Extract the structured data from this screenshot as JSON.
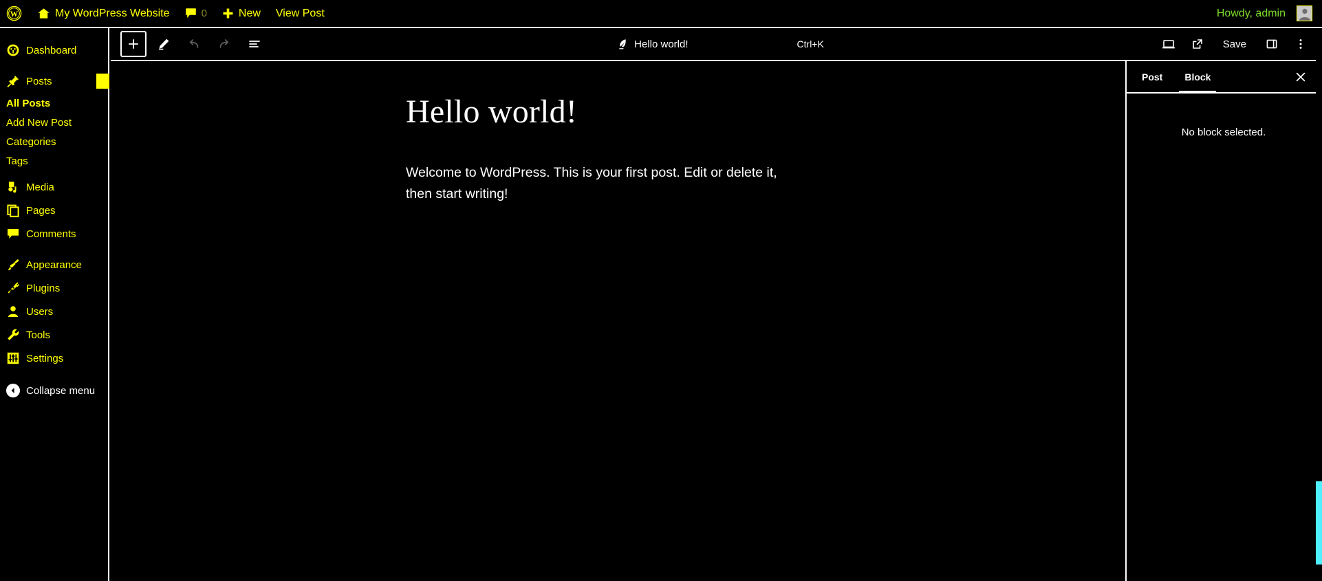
{
  "admin_bar": {
    "logo_icon": "wordpress-logo-icon",
    "site_icon": "home-icon",
    "site_name": "My WordPress Website",
    "comments_icon": "comment-bubble-icon",
    "comments_count": "0",
    "new_icon": "plus-icon",
    "new_label": "New",
    "view_post_label": "View Post",
    "howdy_label": "Howdy, admin",
    "avatar_icon": "user-avatar-icon",
    "howdy_color": "#7ddc2b",
    "accent_color": "#ffff00"
  },
  "sidebar": {
    "items": [
      {
        "label": "Dashboard",
        "icon": "dashboard-gauge-icon"
      },
      {
        "label": "Posts",
        "icon": "pin-icon",
        "current": true
      },
      {
        "label": "Media",
        "icon": "media-music-icon"
      },
      {
        "label": "Pages",
        "icon": "page-document-icon"
      },
      {
        "label": "Comments",
        "icon": "comment-bubble-icon"
      },
      {
        "label": "Appearance",
        "icon": "paint-brush-icon"
      },
      {
        "label": "Plugins",
        "icon": "plug-icon"
      },
      {
        "label": "Users",
        "icon": "user-icon"
      },
      {
        "label": "Tools",
        "icon": "wrench-icon"
      },
      {
        "label": "Settings",
        "icon": "settings-sliders-icon"
      }
    ],
    "posts_submenu": [
      {
        "label": "All Posts",
        "current": true
      },
      {
        "label": "Add New Post",
        "current": false
      },
      {
        "label": "Categories",
        "current": false
      },
      {
        "label": "Tags",
        "current": false
      }
    ],
    "collapse_label": "Collapse menu",
    "collapse_icon": "chevron-left-circle-icon"
  },
  "editor_header": {
    "add_block_icon": "plus-icon",
    "tools_icon": "pencil-edit-icon",
    "undo_icon": "undo-arrow-icon",
    "redo_icon": "redo-arrow-icon",
    "document_overview_icon": "document-list-icon",
    "document_icon": "quill-pen-icon",
    "document_title": "Hello world!",
    "command_hint": "Ctrl+K",
    "view_icon": "desktop-preview-icon",
    "external_link_icon": "external-link-icon",
    "save_label": "Save",
    "sidebar_toggle_icon": "panel-sidebar-icon",
    "options_icon": "three-dots-vertical-icon"
  },
  "canvas": {
    "post_title": "Hello world!",
    "post_paragraph": "Welcome to WordPress. This is your first post. Edit or delete it, then start writing!"
  },
  "inspector": {
    "tabs": [
      {
        "label": "Post",
        "active": false
      },
      {
        "label": "Block",
        "active": true
      }
    ],
    "close_icon": "close-x-icon",
    "empty_message": "No block selected."
  },
  "scrollbar": {
    "thumb_color": "#4ef0ff"
  }
}
